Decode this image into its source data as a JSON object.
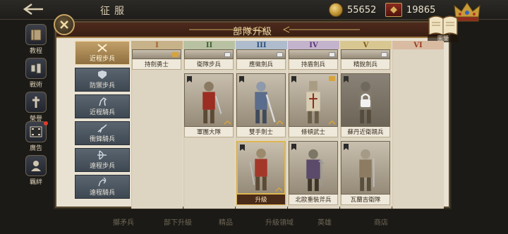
{
  "top": {
    "title": "征服",
    "gold": "55652",
    "gems": "19865"
  },
  "left_nav": [
    {
      "label": "教程",
      "icon": "book-icon"
    },
    {
      "label": "戰術",
      "icon": "tactics-icon"
    },
    {
      "label": "榮譽",
      "icon": "honor-icon"
    },
    {
      "label": "廣告",
      "icon": "film-icon",
      "dot": true
    },
    {
      "label": "羈絆",
      "icon": "bond-icon"
    }
  ],
  "panel": {
    "title": "部隊升級",
    "codex_label": "圖鑒"
  },
  "categories": [
    {
      "label": "近程步兵",
      "active": true
    },
    {
      "label": "防禦步兵"
    },
    {
      "label": "近程騎兵"
    },
    {
      "label": "衝鋒騎兵"
    },
    {
      "label": "遠程步兵"
    },
    {
      "label": "遠程騎兵"
    }
  ],
  "columns": [
    {
      "label": "I",
      "color": "#a0602a",
      "bg": "#c8b28a"
    },
    {
      "label": "II",
      "color": "#3d5f2f",
      "bg": "#b8c2a2"
    },
    {
      "label": "III",
      "color": "#2d4f7a",
      "bg": "#aebccd"
    },
    {
      "label": "IV",
      "color": "#5a3675",
      "bg": "#c4b3cd"
    },
    {
      "label": "V",
      "color": "#7a5a1a",
      "bg": "#d9c792"
    },
    {
      "label": "VI",
      "color": "#9a3a1e",
      "bg": "#d9bba2"
    }
  ],
  "units": {
    "r1": [
      "持劍勇士",
      "衛隊步兵",
      "應徵劍兵",
      "持盾劍兵",
      "精銳劍兵"
    ],
    "r2": [
      "軍團大隊",
      "雙手劍士",
      "條頓武士",
      "蘇丹近衛親兵"
    ],
    "r3": [
      "升級",
      "北歐重裝斧兵",
      "瓦蘭吉衛隊"
    ]
  },
  "bottom": [
    "擲矛兵",
    "部下升級",
    "精品",
    "升級領域",
    "英雄",
    "商店"
  ]
}
